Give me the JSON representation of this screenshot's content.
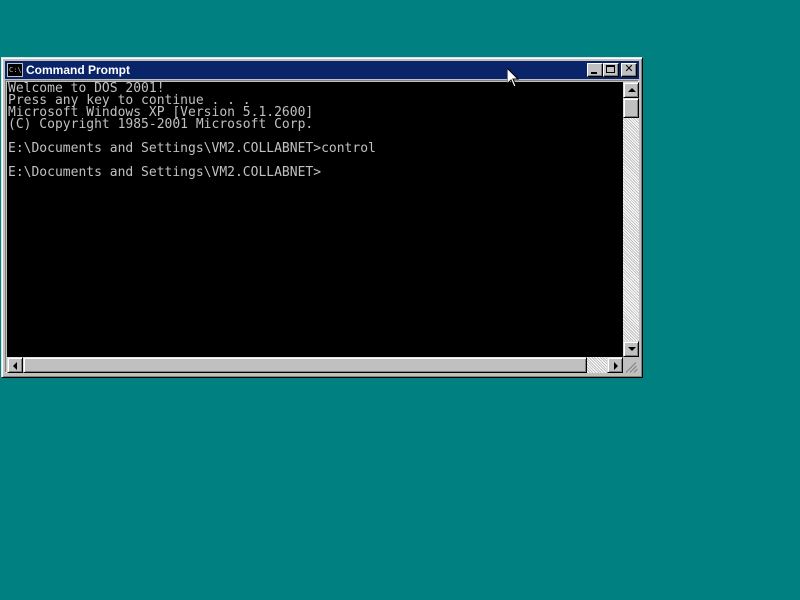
{
  "desktop": {
    "background_color": "#008080"
  },
  "window": {
    "title": "Command Prompt",
    "icon_text": "C:\\",
    "titlebar_color": "#0a246a",
    "controls": {
      "minimize": "minimize-icon",
      "maximize": "maximize-icon",
      "close": "close-icon"
    }
  },
  "console": {
    "background_color": "#000000",
    "text_color": "#c0c0c0",
    "lines": [
      "Welcome to DOS 2001!",
      "Press any key to continue . . .",
      "Microsoft Windows XP [Version 5.1.2600]",
      "(C) Copyright 1985-2001 Microsoft Corp.",
      "",
      "E:\\Documents and Settings\\VM2.COLLABNET>control",
      "",
      "E:\\Documents and Settings\\VM2.COLLABNET>"
    ]
  }
}
